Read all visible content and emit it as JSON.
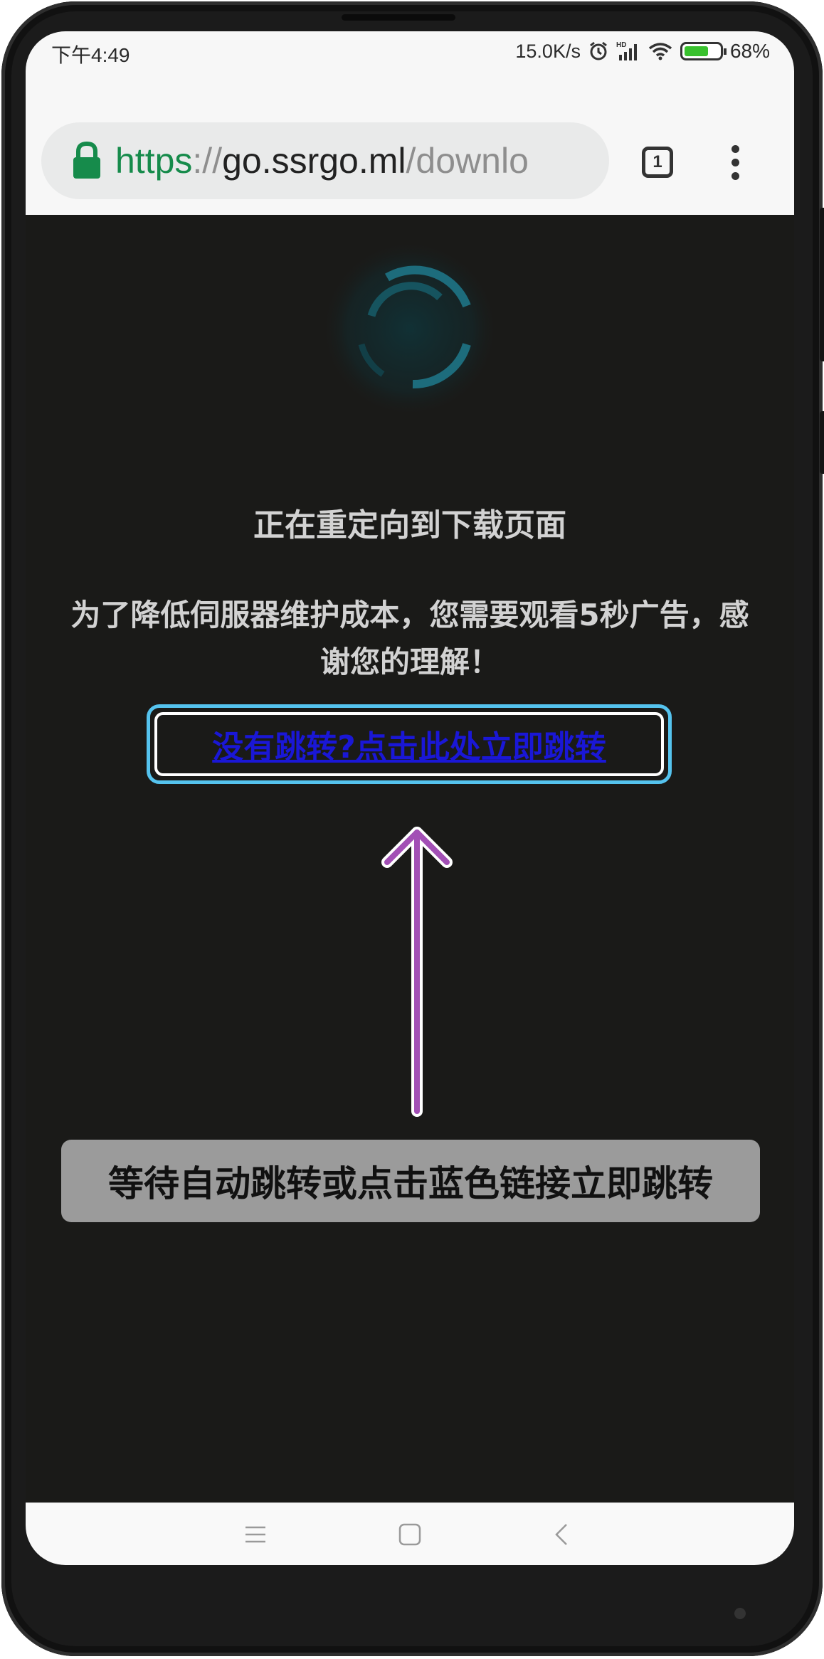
{
  "status_bar": {
    "time": "下午4:49",
    "net_speed": "15.0K/s",
    "battery": "68%",
    "battery_level": 0.68,
    "icons": [
      "alarm-icon",
      "hd-signal-icon",
      "wifi-icon",
      "battery-charging-icon"
    ]
  },
  "browser": {
    "url_scheme": "https",
    "url_separator": "://",
    "url_host": "go.ssrgo.ml",
    "url_path": "/downlo",
    "tab_count": "1",
    "icons": [
      "lock-icon",
      "tabs-icon",
      "overflow-menu-icon"
    ]
  },
  "page": {
    "heading": "正在重定向到下载页面",
    "message": "为了降低伺服器维护成本，您需要观看5秒广告，感谢您的理解！",
    "skip_link": "没有跳转?点击此处立即跳转",
    "annotation": "等待自动跳转或点击蓝色链接立即跳转",
    "colors": {
      "background": "#1a1a18",
      "link": "#1a17d6",
      "highlight_box": "#55c3ee",
      "arrow": "#a24fb5",
      "spinner": "#1d6c7c"
    },
    "icons": [
      "loading-spinner-icon",
      "up-arrow-icon"
    ]
  },
  "nav_bar": {
    "icons": [
      "menu-icon",
      "home-icon",
      "back-icon"
    ]
  }
}
